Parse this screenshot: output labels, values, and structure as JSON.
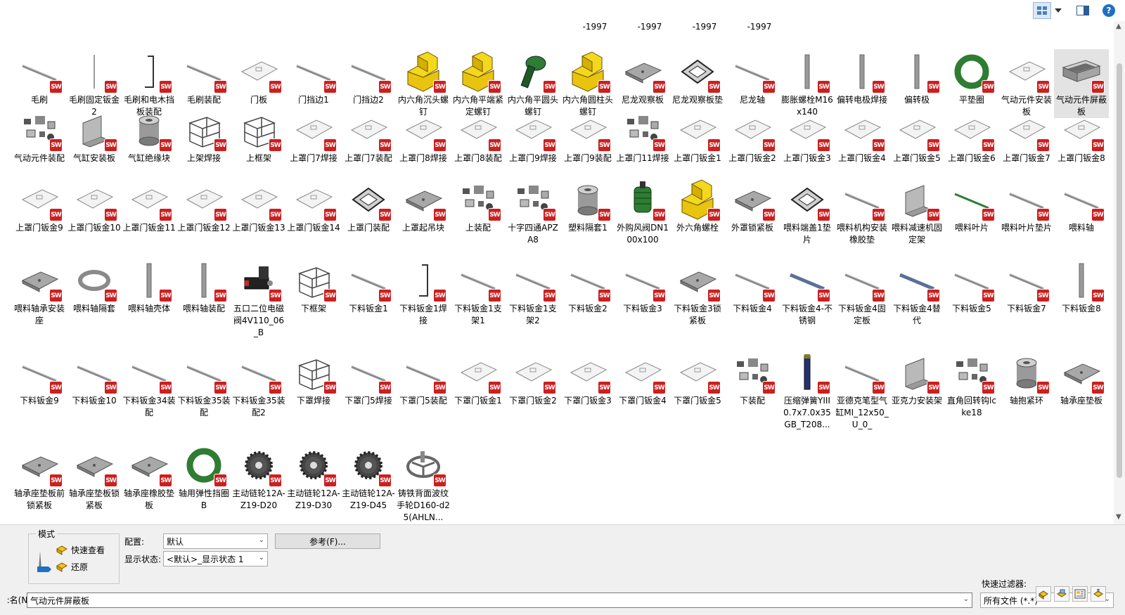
{
  "topbar": {
    "view_icon": "thumbnail-view-icon",
    "dropdown_icon": "dropdown-arrow-icon",
    "preview_icon": "preview-pane-icon",
    "help_label": "?"
  },
  "row0_labels": [
    "-1997",
    "-1997",
    "-1997",
    "-1997"
  ],
  "files": [
    {
      "name": "毛刷",
      "icon": "rod"
    },
    {
      "name": "毛刷固定钣金2",
      "icon": "thin"
    },
    {
      "name": "毛刷和电木挡板装配",
      "icon": "bracket"
    },
    {
      "name": "毛刷装配",
      "icon": "rod"
    },
    {
      "name": "门板",
      "icon": "plate"
    },
    {
      "name": "门挡边1",
      "icon": "rod"
    },
    {
      "name": "门挡边2",
      "icon": "rod"
    },
    {
      "name": "内六角沉头螺钉",
      "icon": "yellow"
    },
    {
      "name": "内六角平端紧定螺钉",
      "icon": "yellow"
    },
    {
      "name": "内六角平圆头螺钉",
      "icon": "greenbolt"
    },
    {
      "name": "内六角圆柱头螺钉",
      "icon": "yellow"
    },
    {
      "name": "尼龙观察板",
      "icon": "grayplate"
    },
    {
      "name": "尼龙观察板垫",
      "icon": "frame"
    },
    {
      "name": "尼龙轴",
      "icon": "rod"
    },
    {
      "name": "膨胀螺栓M16x140",
      "icon": "vbar"
    },
    {
      "name": "偏转电极焊接",
      "icon": "vbar"
    },
    {
      "name": "偏转极",
      "icon": "vbar"
    },
    {
      "name": "平垫圈",
      "icon": "greenring"
    },
    {
      "name": "气动元件安装板",
      "icon": "plate"
    },
    {
      "name": "气动元件屏蔽板",
      "icon": "box"
    },
    {
      "name": "气动元件装配",
      "icon": "parts"
    },
    {
      "name": "气缸安装板",
      "icon": "bracket2"
    },
    {
      "name": "气缸绝缘块",
      "icon": "cylinder"
    },
    {
      "name": "上架焊接",
      "icon": "cage"
    },
    {
      "name": "上框架",
      "icon": "cage"
    },
    {
      "name": "上罩门7焊接",
      "icon": "plate"
    },
    {
      "name": "上罩门7装配",
      "icon": "plate"
    },
    {
      "name": "上罩门8焊接",
      "icon": "plate"
    },
    {
      "name": "上罩门8装配",
      "icon": "plate"
    },
    {
      "name": "上罩门9焊接",
      "icon": "plate"
    },
    {
      "name": "上罩门9装配",
      "icon": "plate"
    },
    {
      "name": "上罩门11焊接",
      "icon": "parts"
    },
    {
      "name": "上罩门钣金1",
      "icon": "plate"
    },
    {
      "name": "上罩门钣金2",
      "icon": "plate"
    },
    {
      "name": "上罩门钣金3",
      "icon": "plate"
    },
    {
      "name": "上罩门钣金4",
      "icon": "plate"
    },
    {
      "name": "上罩门钣金5",
      "icon": "plate"
    },
    {
      "name": "上罩门钣金6",
      "icon": "plate"
    },
    {
      "name": "上罩门钣金7",
      "icon": "plate"
    },
    {
      "name": "上罩门钣金8",
      "icon": "plate"
    },
    {
      "name": "上罩门钣金9",
      "icon": "plate"
    },
    {
      "name": "上罩门钣金10",
      "icon": "plate"
    },
    {
      "name": "上罩门钣金11",
      "icon": "plate"
    },
    {
      "name": "上罩门钣金12",
      "icon": "plate"
    },
    {
      "name": "上罩门钣金13",
      "icon": "plate"
    },
    {
      "name": "上罩门钣金14",
      "icon": "plate"
    },
    {
      "name": "上罩门装配",
      "icon": "frame"
    },
    {
      "name": "上罩起吊块",
      "icon": "grayplate"
    },
    {
      "name": "上装配",
      "icon": "parts"
    },
    {
      "name": "十字四通APZA8",
      "icon": "parts"
    },
    {
      "name": "塑料隔套1",
      "icon": "cylinder"
    },
    {
      "name": "外购风阀DN100x100",
      "icon": "greenspring"
    },
    {
      "name": "外六角螺栓",
      "icon": "yellow"
    },
    {
      "name": "外罩锁紧板",
      "icon": "grayplate"
    },
    {
      "name": "喂料端盖1垫片",
      "icon": "frame"
    },
    {
      "name": "喂料机构安装橡胶垫",
      "icon": "rod"
    },
    {
      "name": "喂料减速机固定架",
      "icon": "bracket2"
    },
    {
      "name": "喂料叶片",
      "icon": "greenrod"
    },
    {
      "name": "喂料叶片垫片",
      "icon": "rod"
    },
    {
      "name": "喂料轴",
      "icon": "rod"
    },
    {
      "name": "喂料轴承安装座",
      "icon": "grayplate"
    },
    {
      "name": "喂料轴隔套",
      "icon": "ring"
    },
    {
      "name": "喂料轴壳体",
      "icon": "vbar"
    },
    {
      "name": "喂料轴装配",
      "icon": "vbar"
    },
    {
      "name": "五口二位电磁阀4V110_06_B",
      "icon": "valve"
    },
    {
      "name": "下框架",
      "icon": "cage"
    },
    {
      "name": "下料钣金1",
      "icon": "rod"
    },
    {
      "name": "下料钣金1焊接",
      "icon": "bracket"
    },
    {
      "name": "下料钣金1支架1",
      "icon": "rod"
    },
    {
      "name": "下料钣金1支架2",
      "icon": "rod"
    },
    {
      "name": "下料钣金2",
      "icon": "rod"
    },
    {
      "name": "下料钣金3",
      "icon": "rod"
    },
    {
      "name": "下料钣金3锁紧板",
      "icon": "grayplate"
    },
    {
      "name": "下料钣金4",
      "icon": "rod"
    },
    {
      "name": "下料钣金4-不锈钢",
      "icon": "bluerod"
    },
    {
      "name": "下料钣金4固定板",
      "icon": "rod"
    },
    {
      "name": "下料钣金4替代",
      "icon": "bluerod"
    },
    {
      "name": "下料钣金5",
      "icon": "rod"
    },
    {
      "name": "下料钣金7",
      "icon": "rod"
    },
    {
      "name": "下料钣金8",
      "icon": "vbar"
    },
    {
      "name": "下料钣金9",
      "icon": "rod"
    },
    {
      "name": "下料钣金10",
      "icon": "rod"
    },
    {
      "name": "下料钣金34装配",
      "icon": "rod"
    },
    {
      "name": "下料钣金35装配",
      "icon": "rod"
    },
    {
      "name": "下料钣金35装配2",
      "icon": "rod"
    },
    {
      "name": "下罩焊接",
      "icon": "cage"
    },
    {
      "name": "下罩门5焊接",
      "icon": "rod"
    },
    {
      "name": "下罩门5装配",
      "icon": "rod"
    },
    {
      "name": "下罩门钣金1",
      "icon": "plate"
    },
    {
      "name": "下罩门钣金2",
      "icon": "plate"
    },
    {
      "name": "下罩门钣金3",
      "icon": "plate"
    },
    {
      "name": "下罩门钣金4",
      "icon": "plate"
    },
    {
      "name": "下罩门钣金5",
      "icon": "plate"
    },
    {
      "name": "下装配",
      "icon": "parts"
    },
    {
      "name": "压缩弹簧YIII0.7x7.0x35GB_T208...",
      "icon": "navybar"
    },
    {
      "name": "亚德克笔型气缸MI_12x50_U_0_",
      "icon": "rod"
    },
    {
      "name": "亚克力安装架",
      "icon": "bracket2"
    },
    {
      "name": "直角回转钩lcke18",
      "icon": "parts"
    },
    {
      "name": "轴抱紧环",
      "icon": "cylinder"
    },
    {
      "name": "轴承座垫板",
      "icon": "grayplate"
    },
    {
      "name": "轴承座垫板前锁紧板",
      "icon": "grayplate"
    },
    {
      "name": "轴承座垫板锁紧板",
      "icon": "grayplate"
    },
    {
      "name": "轴承座橡胶垫板",
      "icon": "grayplate"
    },
    {
      "name": "轴用弹性挡圈B",
      "icon": "greenring"
    },
    {
      "name": "主动链轮12A-Z19-D20",
      "icon": "gear"
    },
    {
      "name": "主动链轮12A-Z19-D30",
      "icon": "gear"
    },
    {
      "name": "主动链轮12A-Z19-D45",
      "icon": "gear"
    },
    {
      "name": "铸铁背面波纹手轮D160-d25(AHLN...",
      "icon": "wheel"
    }
  ],
  "selected_index": 19,
  "mode": {
    "title": "模式",
    "quick_view": "快速查看",
    "restore": "还原"
  },
  "config": {
    "label": "配置:",
    "value": "默认"
  },
  "display_state": {
    "label": "显示状态:",
    "value": "<默认>_显示状态 1"
  },
  "reference_button": "参考(F)...",
  "quick_filter_label": "快速过滤器:",
  "filename": {
    "label": "名(N):",
    "value": "气动元件屏蔽板"
  },
  "filetype": {
    "value": "所有文件 (*.*)"
  },
  "colors": {
    "sw_badge": "#cc1f1f",
    "selection": "#e3e3e3",
    "yellow_part": "#f2d01a",
    "green_part": "#2e7d32"
  }
}
